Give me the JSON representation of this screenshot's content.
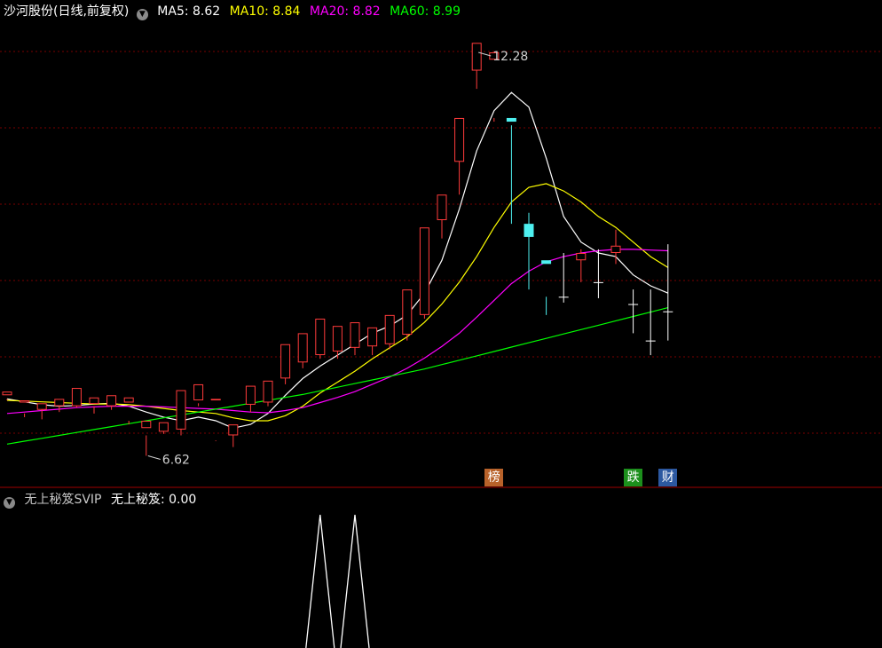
{
  "header": {
    "title": "沙河股份(日线,前复权)",
    "ma": [
      {
        "label": "MA5: 8.62",
        "color": "#ffffff"
      },
      {
        "label": "MA10: 8.84",
        "color": "#ffff00"
      },
      {
        "label": "MA20: 8.82",
        "color": "#ff00ff"
      },
      {
        "label": "MA60: 8.99",
        "color": "#00ff00"
      }
    ]
  },
  "indicator": {
    "name": "无上秘笈SVIP",
    "value_label": "无上秘笈: 0.00",
    "line_color": "#ffffff",
    "peak_value": 1,
    "spikes": [
      {
        "index": 18,
        "value": 1
      },
      {
        "index": 20,
        "value": 1
      }
    ]
  },
  "badges": [
    {
      "text": "榜",
      "index": 28,
      "color": "#b8622a"
    },
    {
      "text": "跌",
      "index": 36,
      "color": "#1c8f1c"
    },
    {
      "text": "财",
      "index": 38,
      "color": "#2c58a0"
    }
  ],
  "colors": {
    "up": "#ff3b3b",
    "down": "#4ef0f0",
    "grid": "#7a0000",
    "separator": "#a00000"
  },
  "chart_data": {
    "type": "candlestick",
    "y_range": [
      6.2,
      12.6
    ],
    "high_label": "12.28",
    "low_label": "6.62",
    "ohlc": [
      [
        7.45,
        7.5,
        7.4,
        7.38
      ],
      [
        7.35,
        7.38,
        7.2,
        7.15
      ],
      [
        7.25,
        7.34,
        7.3,
        7.12
      ],
      [
        7.3,
        7.4,
        7.38,
        7.22
      ],
      [
        7.3,
        7.55,
        7.38,
        7.28
      ],
      [
        7.33,
        7.42,
        7.3,
        7.2
      ],
      [
        7.3,
        7.45,
        7.4,
        7.25
      ],
      [
        7.35,
        7.42,
        7.1,
        7.05
      ],
      [
        7.0,
        7.1,
        6.9,
        6.62
      ],
      [
        6.95,
        7.08,
        7.07,
        6.92
      ],
      [
        6.98,
        7.52,
        7.45,
        6.9
      ],
      [
        7.38,
        7.6,
        7.34,
        7.3
      ],
      [
        7.38,
        7.4,
        6.83,
        6.82
      ],
      [
        6.9,
        7.05,
        7.02,
        6.74
      ],
      [
        7.32,
        7.58,
        7.35,
        7.22
      ],
      [
        7.35,
        7.65,
        7.55,
        7.3
      ],
      [
        7.68,
        8.15,
        8.05,
        7.6
      ],
      [
        7.9,
        8.3,
        8.15,
        7.82
      ],
      [
        8.0,
        8.5,
        8.2,
        7.95
      ],
      [
        8.05,
        8.4,
        8.2,
        7.95
      ],
      [
        8.1,
        8.45,
        8.2,
        8.0
      ],
      [
        8.12,
        8.38,
        8.25,
        8.0
      ],
      [
        8.15,
        8.55,
        8.35,
        8.08
      ],
      [
        8.28,
        8.9,
        8.7,
        8.2
      ],
      [
        8.55,
        9.75,
        9.55,
        8.5
      ],
      [
        9.85,
        10.2,
        9.9,
        9.6
      ],
      [
        10.65,
        11.25,
        11.0,
        10.2
      ],
      [
        11.9,
        12.28,
        12.15,
        11.65
      ],
      [
        12.05,
        12.15,
        11.25,
        11.2
      ],
      [
        11.25,
        11.2,
        11.15,
        9.8
      ],
      [
        9.8,
        9.62,
        9.95,
        8.9
      ],
      [
        9.3,
        9.25,
        8.8,
        8.55
      ],
      [
        8.8,
        8.8,
        9.4,
        8.72
      ],
      [
        9.3,
        9.4,
        9.45,
        9.0
      ],
      [
        9.0,
        9.0,
        9.45,
        8.78
      ],
      [
        9.4,
        9.5,
        9.72,
        9.25
      ],
      [
        8.7,
        8.7,
        8.9,
        8.3
      ],
      [
        8.2,
        8.2,
        8.9,
        8.0
      ],
      [
        8.6,
        8.6,
        9.52,
        8.2
      ]
    ],
    "ma_lines": [
      {
        "name": "MA5",
        "color": "#ffffff",
        "values": [
          7.4,
          7.36,
          7.32,
          7.3,
          7.31,
          7.33,
          7.34,
          7.3,
          7.22,
          7.15,
          7.1,
          7.15,
          7.1,
          7.0,
          7.05,
          7.2,
          7.45,
          7.68,
          7.85,
          8.0,
          8.15,
          8.3,
          8.4,
          8.55,
          8.85,
          9.3,
          10.0,
          10.8,
          11.35,
          11.6,
          11.4,
          10.7,
          9.9,
          9.55,
          9.4,
          9.35,
          9.1,
          8.95,
          8.85
        ]
      },
      {
        "name": "MA10",
        "color": "#ffff00",
        "values": [
          7.38,
          7.37,
          7.36,
          7.35,
          7.34,
          7.33,
          7.33,
          7.32,
          7.3,
          7.27,
          7.24,
          7.22,
          7.2,
          7.14,
          7.1,
          7.1,
          7.17,
          7.3,
          7.48,
          7.63,
          7.78,
          7.95,
          8.1,
          8.25,
          8.45,
          8.7,
          9.0,
          9.35,
          9.75,
          10.1,
          10.3,
          10.35,
          10.25,
          10.1,
          9.9,
          9.75,
          9.55,
          9.35,
          9.2
        ]
      },
      {
        "name": "MA20",
        "color": "#ff00ff",
        "values": [
          7.2,
          7.22,
          7.24,
          7.26,
          7.28,
          7.29,
          7.3,
          7.3,
          7.3,
          7.29,
          7.28,
          7.27,
          7.26,
          7.24,
          7.22,
          7.21,
          7.24,
          7.28,
          7.35,
          7.42,
          7.5,
          7.6,
          7.7,
          7.82,
          7.96,
          8.12,
          8.3,
          8.52,
          8.75,
          8.98,
          9.15,
          9.28,
          9.35,
          9.4,
          9.43,
          9.45,
          9.45,
          9.44,
          9.43
        ]
      },
      {
        "name": "MA60",
        "color": "#00ff00",
        "values": [
          6.78,
          6.82,
          6.86,
          6.9,
          6.94,
          6.98,
          7.02,
          7.06,
          7.1,
          7.14,
          7.18,
          7.22,
          7.26,
          7.3,
          7.34,
          7.38,
          7.42,
          7.46,
          7.51,
          7.56,
          7.61,
          7.66,
          7.71,
          7.76,
          7.81,
          7.87,
          7.93,
          7.99,
          8.05,
          8.11,
          8.17,
          8.23,
          8.29,
          8.35,
          8.41,
          8.47,
          8.53,
          8.59,
          8.65
        ]
      }
    ]
  }
}
